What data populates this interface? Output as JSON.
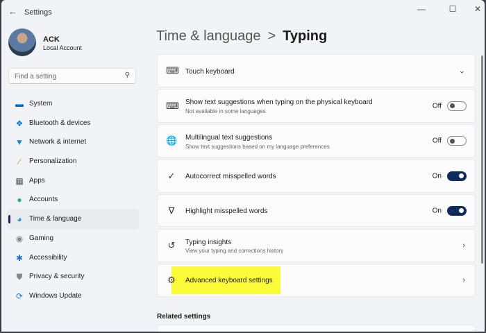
{
  "window": {
    "title": "Settings",
    "back_icon": "arrow-left",
    "controls": [
      "minimize",
      "maximize",
      "close"
    ]
  },
  "user": {
    "name": "ACK",
    "type": "Local Account"
  },
  "search": {
    "placeholder": "Find a setting"
  },
  "nav": [
    {
      "label": "System",
      "icon": "monitor",
      "color": "#0a6fc2"
    },
    {
      "label": "Bluetooth & devices",
      "icon": "bluetooth",
      "color": "#0a78d4"
    },
    {
      "label": "Network & internet",
      "icon": "wifi",
      "color": "#1a8ad6"
    },
    {
      "label": "Personalization",
      "icon": "brush",
      "color": "#e08a3c"
    },
    {
      "label": "Apps",
      "icon": "apps",
      "color": "#555"
    },
    {
      "label": "Accounts",
      "icon": "person",
      "color": "#2aa876"
    },
    {
      "label": "Time & language",
      "icon": "globe-clock",
      "color": "#1a8ad6"
    },
    {
      "label": "Gaming",
      "icon": "gamepad",
      "color": "#888"
    },
    {
      "label": "Accessibility",
      "icon": "accessibility",
      "color": "#1a6fc2"
    },
    {
      "label": "Privacy & security",
      "icon": "shield",
      "color": "#888"
    },
    {
      "label": "Windows Update",
      "icon": "refresh",
      "color": "#0a78d4"
    }
  ],
  "active_nav": "Time & language",
  "breadcrumb": {
    "parent": "Time & language",
    "separator": ">",
    "current": "Typing"
  },
  "settings": [
    {
      "title": "Touch keyboard",
      "icon": "keyboard",
      "control": "expand"
    },
    {
      "title": "Show text suggestions when typing on the physical keyboard",
      "subtitle": "Not available in some languages",
      "icon": "keyboard",
      "state": "Off",
      "on": false
    },
    {
      "title": "Multilingual text suggestions",
      "subtitle": "Show text suggestions based on my language preferences",
      "icon": "translate",
      "state": "Off",
      "on": false
    },
    {
      "title": "Autocorrect misspelled words",
      "icon": "autocorrect",
      "state": "On",
      "on": true
    },
    {
      "title": "Highlight misspelled words",
      "icon": "highlight",
      "state": "On",
      "on": true
    },
    {
      "title": "Typing insights",
      "subtitle": "View your typing and corrections history",
      "icon": "history",
      "control": "chevron"
    },
    {
      "title": "Advanced keyboard settings",
      "icon": "gear",
      "control": "chevron",
      "highlight": "#fbfb3a"
    }
  ],
  "related": {
    "label": "Related settings"
  }
}
